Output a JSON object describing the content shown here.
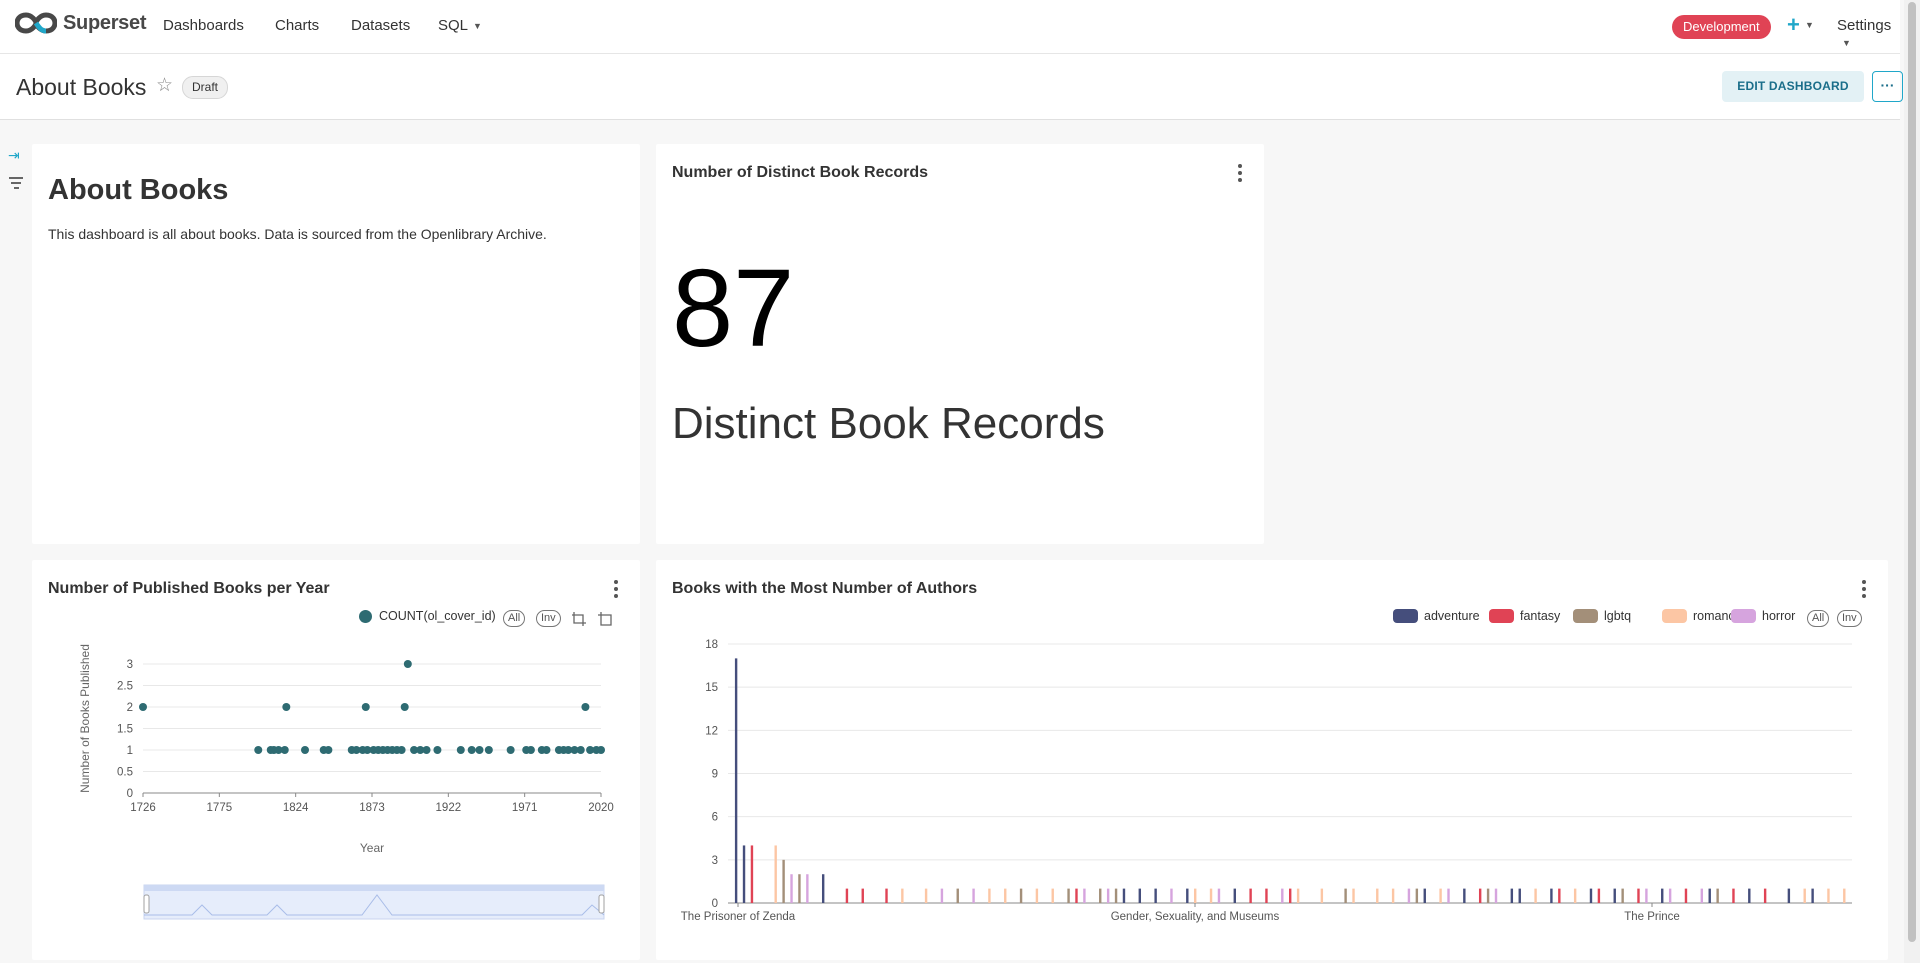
{
  "nav": {
    "brand": "Superset",
    "items": [
      "Dashboards",
      "Charts",
      "Datasets",
      "SQL"
    ],
    "env_badge": "Development",
    "plus": "+",
    "settings": "Settings"
  },
  "header": {
    "title": "About Books",
    "status": "Draft",
    "edit_button": "EDIT DASHBOARD",
    "more_button": "···"
  },
  "markdown_card": {
    "title": "About Books",
    "text": "This dashboard is all about books. Data is sourced from the Openlibrary Archive."
  },
  "big_number_card": {
    "title": "Number of Distinct Book Records",
    "value": "87",
    "subheader": "Distinct Book Records"
  },
  "scatter_card": {
    "title": "Number of Published Books per Year",
    "legend": "COUNT(ol_cover_id)",
    "legend_all": "All",
    "legend_inv": "Inv"
  },
  "bar_card": {
    "title": "Books with the Most Number of Authors",
    "legend_all": "All",
    "legend_inv": "Inv"
  },
  "colors": {
    "accent": "#20a7c9",
    "scatter": "#2e6b72",
    "adventure": "#454e7c",
    "fantasy": "#e04355",
    "lgbtq": "#a38f79",
    "romance": "#fcc6a4",
    "horror": "#d6a4de"
  },
  "chart_data": [
    {
      "type": "scatter",
      "title": "Number of Published Books per Year",
      "xlabel": "Year",
      "ylabel": "Number of Books Published",
      "xlim": [
        1726,
        2020
      ],
      "ylim": [
        0,
        3
      ],
      "x_ticks": [
        "1726",
        "1775",
        "1824",
        "1873",
        "1922",
        "1971",
        "2020"
      ],
      "y_ticks": [
        "0",
        "0.5",
        "1",
        "1.5",
        "2",
        "2.5",
        "3"
      ],
      "series": [
        {
          "name": "COUNT(ol_cover_id)",
          "points": [
            [
              1726,
              2
            ],
            [
              1800,
              1
            ],
            [
              1808,
              1
            ],
            [
              1810,
              1
            ],
            [
              1813,
              1
            ],
            [
              1817,
              1
            ],
            [
              1818,
              2
            ],
            [
              1830,
              1
            ],
            [
              1842,
              1
            ],
            [
              1845,
              1
            ],
            [
              1860,
              1
            ],
            [
              1863,
              1
            ],
            [
              1867,
              1
            ],
            [
              1869,
              2
            ],
            [
              1870,
              1
            ],
            [
              1874,
              1
            ],
            [
              1877,
              1
            ],
            [
              1880,
              1
            ],
            [
              1883,
              1
            ],
            [
              1886,
              1
            ],
            [
              1889,
              1
            ],
            [
              1892,
              1
            ],
            [
              1894,
              2
            ],
            [
              1896,
              3
            ],
            [
              1900,
              1
            ],
            [
              1904,
              1
            ],
            [
              1908,
              1
            ],
            [
              1915,
              1
            ],
            [
              1930,
              1
            ],
            [
              1937,
              1
            ],
            [
              1942,
              1
            ],
            [
              1948,
              1
            ],
            [
              1962,
              1
            ],
            [
              1972,
              1
            ],
            [
              1975,
              1
            ],
            [
              1982,
              1
            ],
            [
              1985,
              1
            ],
            [
              1993,
              1
            ],
            [
              1996,
              1
            ],
            [
              1999,
              1
            ],
            [
              2003,
              1
            ],
            [
              2007,
              1
            ],
            [
              2010,
              2
            ],
            [
              2013,
              1
            ],
            [
              2017,
              1
            ],
            [
              2020,
              1
            ]
          ]
        }
      ]
    },
    {
      "type": "bar",
      "title": "Books with the Most Number of Authors",
      "ylim": [
        0,
        18
      ],
      "y_ticks": [
        "0",
        "3",
        "6",
        "9",
        "12",
        "15",
        "18"
      ],
      "x_tick_labels": [
        "The Prisoner of Zenda",
        "Gender, Sexuality, and Museums",
        "The Prince"
      ],
      "series": [
        {
          "name": "adventure",
          "values": [
            [
              1,
              17
            ],
            [
              2,
              4
            ],
            [
              12,
              2
            ],
            [
              50,
              1
            ],
            [
              52,
              1
            ],
            [
              54,
              1
            ],
            [
              58,
              1
            ],
            [
              64,
              1
            ],
            [
              88,
              1
            ],
            [
              93,
              1
            ],
            [
              99,
              1
            ],
            [
              100,
              1
            ],
            [
              104,
              1
            ],
            [
              109,
              1
            ],
            [
              112,
              1
            ],
            [
              118,
              1
            ],
            [
              124,
              1
            ],
            [
              129,
              1
            ],
            [
              134,
              1
            ],
            [
              137,
              1
            ]
          ]
        },
        {
          "name": "fantasy",
          "values": [
            [
              3,
              4
            ],
            [
              15,
              1
            ],
            [
              17,
              1
            ],
            [
              20,
              1
            ],
            [
              44,
              1
            ],
            [
              66,
              1
            ],
            [
              68,
              1
            ],
            [
              71,
              1
            ],
            [
              95,
              1
            ],
            [
              105,
              1
            ],
            [
              110,
              1
            ],
            [
              115,
              1
            ],
            [
              121,
              1
            ],
            [
              127,
              1
            ],
            [
              131,
              1
            ]
          ]
        },
        {
          "name": "lgbtq",
          "values": [
            [
              7,
              3
            ],
            [
              9,
              2
            ],
            [
              29,
              1
            ],
            [
              37,
              1
            ],
            [
              43,
              1
            ],
            [
              47,
              1
            ],
            [
              49,
              1
            ],
            [
              78,
              1
            ],
            [
              87,
              1
            ],
            [
              96,
              1
            ],
            [
              113,
              1
            ],
            [
              125,
              1
            ]
          ]
        },
        {
          "name": "romance",
          "values": [
            [
              6,
              4
            ],
            [
              22,
              1
            ],
            [
              25,
              1
            ],
            [
              33,
              1
            ],
            [
              35,
              1
            ],
            [
              39,
              1
            ],
            [
              41,
              1
            ],
            [
              59,
              1
            ],
            [
              61,
              1
            ],
            [
              72,
              1
            ],
            [
              75,
              1
            ],
            [
              79,
              1
            ],
            [
              82,
              1
            ],
            [
              84,
              1
            ],
            [
              90,
              1
            ],
            [
              102,
              1
            ],
            [
              107,
              1
            ],
            [
              136,
              1
            ],
            [
              139,
              1
            ],
            [
              141,
              1
            ]
          ]
        },
        {
          "name": "horror",
          "values": [
            [
              8,
              2
            ],
            [
              10,
              2
            ],
            [
              27,
              1
            ],
            [
              31,
              1
            ],
            [
              45,
              1
            ],
            [
              48,
              1
            ],
            [
              56,
              1
            ],
            [
              62,
              1
            ],
            [
              70,
              1
            ],
            [
              86,
              1
            ],
            [
              91,
              1
            ],
            [
              97,
              1
            ],
            [
              116,
              1
            ],
            [
              119,
              1
            ],
            [
              123,
              1
            ]
          ]
        }
      ]
    }
  ]
}
